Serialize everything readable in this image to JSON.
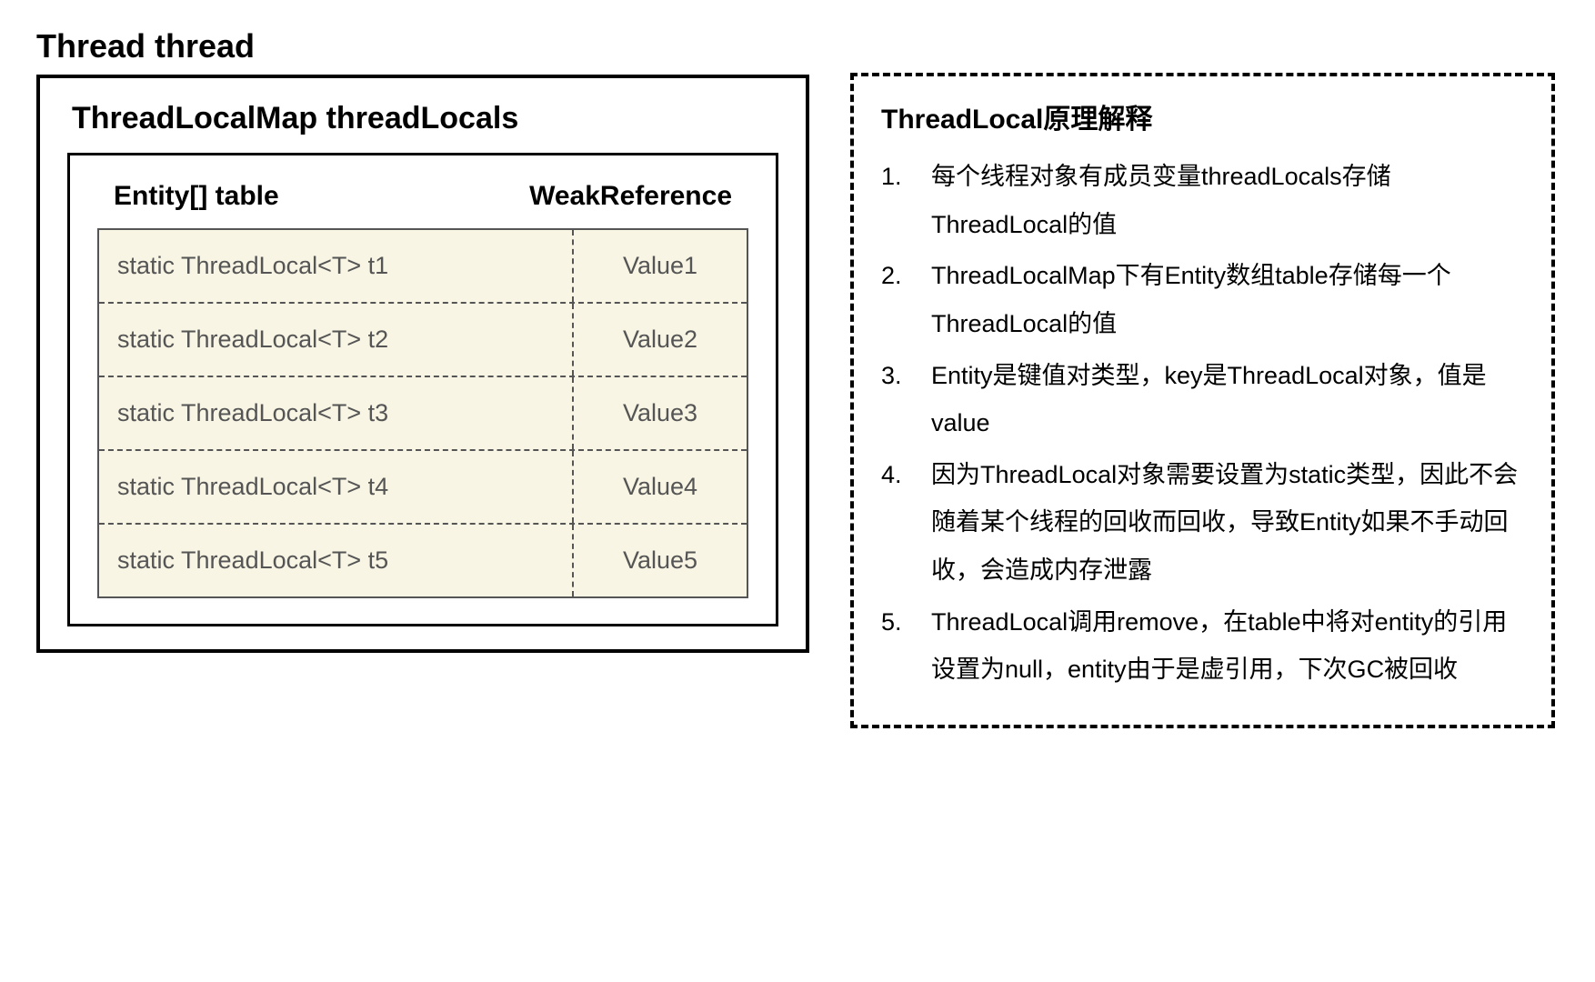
{
  "diagram": {
    "thread_title": "Thread thread",
    "map_title": "ThreadLocalMap threadLocals",
    "table_header_left": "Entity[] table",
    "table_header_right": "WeakReference",
    "rows": [
      {
        "key": "static ThreadLocal<T> t1",
        "value": "Value1"
      },
      {
        "key": "static ThreadLocal<T> t2",
        "value": "Value2"
      },
      {
        "key": "static ThreadLocal<T> t3",
        "value": "Value3"
      },
      {
        "key": "static ThreadLocal<T> t4",
        "value": "Value4"
      },
      {
        "key": "static ThreadLocal<T> t5",
        "value": "Value5"
      }
    ]
  },
  "explanation": {
    "title": "ThreadLocal原理解释",
    "items": [
      "每个线程对象有成员变量threadLocals存储ThreadLocal的值",
      "ThreadLocalMap下有Entity数组table存储每一个ThreadLocal的值",
      "Entity是键值对类型，key是ThreadLocal对象，值是value",
      "因为ThreadLocal对象需要设置为static类型，因此不会随着某个线程的回收而回收，导致Entity如果不手动回收，会造成内存泄露",
      "ThreadLocal调用remove，在table中将对entity的引用设置为null，entity由于是虚引用，下次GC被回收"
    ]
  }
}
